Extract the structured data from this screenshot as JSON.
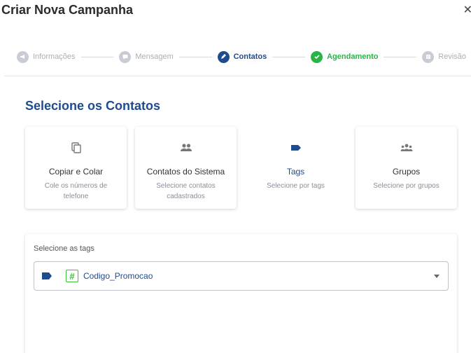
{
  "dialog": {
    "title": "Criar Nova Campanha",
    "close_icon": "close-icon"
  },
  "stepper": {
    "steps": [
      {
        "label": "Informações",
        "state": "pending",
        "icon": "megaphone-icon"
      },
      {
        "label": "Mensagem",
        "state": "pending",
        "icon": "message-icon"
      },
      {
        "label": "Contatos",
        "state": "active",
        "icon": "pencil-icon"
      },
      {
        "label": "Agendamento",
        "state": "done",
        "icon": "check-icon"
      },
      {
        "label": "Revisão",
        "state": "pending",
        "icon": "review-icon"
      }
    ]
  },
  "section": {
    "title": "Selecione os Contatos"
  },
  "options": [
    {
      "title": "Copiar e Colar",
      "desc": "Cole os números de telefone",
      "icon": "copy-icon",
      "selected": false
    },
    {
      "title": "Contatos do Sistema",
      "desc": "Selecione contatos cadastrados",
      "icon": "people-icon",
      "selected": false
    },
    {
      "title": "Tags",
      "desc": "Selecione por tags",
      "icon": "tag-icon",
      "selected": true
    },
    {
      "title": "Grupos",
      "desc": "Selecione por grupos",
      "icon": "groups-icon",
      "selected": false
    }
  ],
  "tags_panel": {
    "label": "Selecione as tags",
    "selected_tag": "Codigo_Promocao",
    "hash_symbol": "#"
  },
  "colors": {
    "primary": "#1f4b8f",
    "success": "#28b446",
    "muted": "#a9aeb7",
    "tag_green": "#39c23a"
  }
}
